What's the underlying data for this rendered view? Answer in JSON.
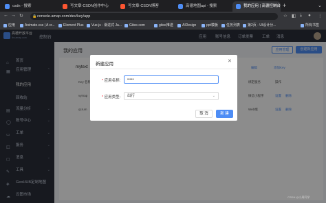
{
  "browser": {
    "tabs": [
      {
        "label": "csdn - 搜索",
        "color": "#4e8df5"
      },
      {
        "label": "写文章-CSDN创作中心",
        "color": "#fc5531"
      },
      {
        "label": "写文章-CSDN博客",
        "color": "#fc5531"
      },
      {
        "label": "高德地图api - 搜索",
        "color": "#4e8df5"
      },
      {
        "label": "我的应用 | 高德控制台",
        "color": "#4e8df5"
      }
    ],
    "url": "console.amap.com/dev/key/app",
    "bookmarks": [
      "应用",
      "Animate.css | A cr...",
      "Element Plus",
      "Vue.js - 渐进式 Ja...",
      "Gitee.com",
      "gitee推送",
      "AIDesign",
      "ppt模板",
      "任务列表",
      "第2页 - UI设计分...",
      "所有书签"
    ]
  },
  "header": {
    "logo_text": "高德开放平台",
    "logo_sub": "lbs.amap.com",
    "console": "控制台",
    "nav": [
      "应用",
      "账号信息",
      "订单发票",
      "工单",
      "消息"
    ]
  },
  "sidebar": {
    "items": [
      {
        "label": "首页",
        "icon": "home-icon",
        "glyph": "⌂"
      },
      {
        "label": "应用管理",
        "icon": "app-icon",
        "glyph": "▦",
        "chev": "⌃"
      },
      {
        "label": "我的应用",
        "icon": "",
        "glyph": ""
      },
      {
        "label": "回收站",
        "icon": "",
        "glyph": ""
      },
      {
        "label": "流量分析",
        "icon": "chart-icon",
        "glyph": "▤",
        "chev": "⌄"
      },
      {
        "label": "账号中心",
        "icon": "user-icon",
        "glyph": "◯",
        "chev": "⌄"
      },
      {
        "label": "工单",
        "icon": "ticket-icon",
        "glyph": "▭",
        "chev": "⌄"
      },
      {
        "label": "服务",
        "icon": "service-icon",
        "glyph": "◫",
        "chev": "⌄"
      },
      {
        "label": "消息",
        "icon": "message-icon",
        "glyph": "▢",
        "chev": "⌄"
      },
      {
        "label": "工具",
        "icon": "tool-icon",
        "glyph": "✎",
        "chev": "⌄"
      },
      {
        "label": "GeoHUB定制地图",
        "icon": "map-icon",
        "glyph": "◈"
      },
      {
        "label": "云图市场",
        "icon": "cloud-icon",
        "glyph": "☁"
      }
    ]
  },
  "main": {
    "title": "我的应用",
    "btn_manage": "应用管理",
    "btn_create": "创建新应用",
    "app_title": "mytext",
    "actions": [
      "编辑",
      "添加Key"
    ],
    "columns": [
      "Key 名称",
      "Key",
      "绑定服务",
      "操作"
    ],
    "rows": [
      {
        "name": "vymap",
        "service": "微信小程序",
        "op1": "设置",
        "op2": "删除"
      },
      {
        "name": "qcrum",
        "service": "Web端",
        "op1": "设置",
        "op2": "删除"
      }
    ]
  },
  "modal": {
    "title": "新建应用",
    "name_label": "应用名称:",
    "name_value": "•••••",
    "type_label": "应用类型:",
    "type_value": "出行",
    "cancel": "取 消",
    "ok": "新 建"
  },
  "watermark": "CSDN @小周同学"
}
